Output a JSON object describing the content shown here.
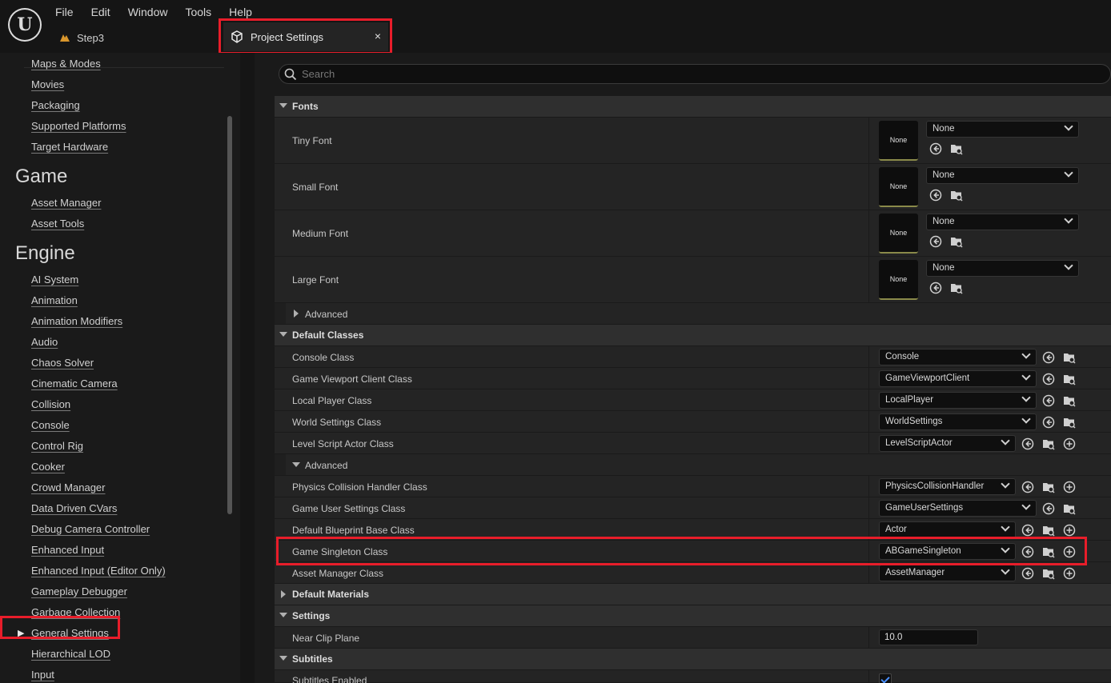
{
  "menu": [
    "File",
    "Edit",
    "Window",
    "Tools",
    "Help"
  ],
  "level_tab": "Step3",
  "doc_tab": {
    "title": "Project Settings",
    "close": "×"
  },
  "sidebar": {
    "items_top": [
      "Maps & Modes",
      "Movies",
      "Packaging",
      "Supported Platforms",
      "Target Hardware"
    ],
    "game_heading": "Game",
    "game_items": [
      "Asset Manager",
      "Asset Tools"
    ],
    "engine_heading": "Engine",
    "engine_items": [
      "AI System",
      "Animation",
      "Animation Modifiers",
      "Audio",
      "Chaos Solver",
      "Cinematic Camera",
      "Collision",
      "Console",
      "Control Rig",
      "Cooker",
      "Crowd Manager",
      "Data Driven CVars",
      "Debug Camera Controller",
      "Enhanced Input",
      "Enhanced Input (Editor Only)",
      "Gameplay Debugger",
      "Garbage Collection",
      "General Settings",
      "Hierarchical LOD",
      "Input"
    ],
    "selected": "General Settings"
  },
  "search": {
    "placeholder": "Search"
  },
  "fonts": {
    "label": "Fonts",
    "rows": [
      {
        "name": "Tiny Font",
        "thumb": "None",
        "value": "None"
      },
      {
        "name": "Small Font",
        "thumb": "None",
        "value": "None"
      },
      {
        "name": "Medium Font",
        "thumb": "None",
        "value": "None"
      },
      {
        "name": "Large Font",
        "thumb": "None",
        "value": "None"
      }
    ],
    "advanced": "Advanced"
  },
  "default_classes": {
    "label": "Default Classes",
    "rows": [
      {
        "name": "Console Class",
        "value": "Console"
      },
      {
        "name": "Game Viewport Client Class",
        "value": "GameViewportClient"
      },
      {
        "name": "Local Player Class",
        "value": "LocalPlayer"
      },
      {
        "name": "World Settings Class",
        "value": "WorldSettings"
      },
      {
        "name": "Level Script Actor Class",
        "value": "LevelScriptActor"
      }
    ],
    "advanced": "Advanced",
    "advanced_rows": [
      {
        "name": "Physics Collision Handler Class",
        "value": "PhysicsCollisionHandler"
      },
      {
        "name": "Game User Settings Class",
        "value": "GameUserSettings"
      },
      {
        "name": "Default Blueprint Base Class",
        "value": "Actor"
      },
      {
        "name": "Game Singleton Class",
        "value": "ABGameSingleton"
      },
      {
        "name": "Asset Manager Class",
        "value": "AssetManager"
      }
    ]
  },
  "default_materials": {
    "label": "Default Materials"
  },
  "settings": {
    "label": "Settings",
    "near_clip_label": "Near Clip Plane",
    "near_clip_value": "10.0"
  },
  "subtitles": {
    "label": "Subtitles",
    "enabled_label": "Subtitles Enabled",
    "enabled": true
  },
  "colors": {
    "highlight": "#e81d2a",
    "link_underline": "#7a7a7a",
    "check": "#4a90ff"
  }
}
